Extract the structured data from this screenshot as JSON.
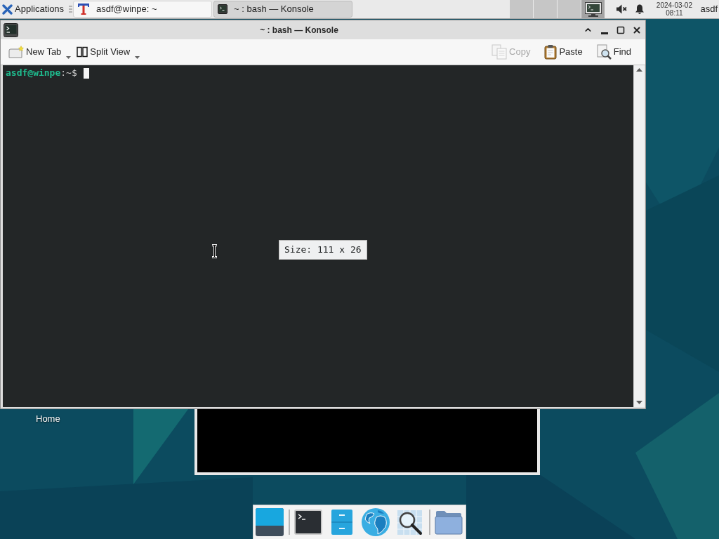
{
  "top_panel": {
    "menu_label": "Applications",
    "tasks": [
      {
        "title": "asdf@winpe: ~",
        "kind": "tlogo",
        "selected": false
      },
      {
        "title": "~ : bash — Konsole",
        "kind": "terminal",
        "selected": true
      }
    ],
    "workspaces": [
      {
        "selected": false
      },
      {
        "selected": false
      },
      {
        "selected": false
      },
      {
        "selected": true
      }
    ],
    "volume": {
      "muted": true
    },
    "clock": {
      "date": "2024-03-02",
      "time": "08:11"
    },
    "user": "asdf"
  },
  "desktop": {
    "icons": [
      {
        "label": "Home"
      }
    ]
  },
  "konsole": {
    "title": "~ : bash — Konsole",
    "toolbar": {
      "left": [
        {
          "label": "New Tab",
          "kind": "newtab",
          "has_menu": true,
          "disabled": false
        },
        {
          "label": "Split View",
          "kind": "split",
          "has_menu": true,
          "disabled": false
        }
      ],
      "right": [
        {
          "label": "Copy",
          "kind": "copy",
          "has_menu": false,
          "disabled": true
        },
        {
          "label": "Paste",
          "kind": "paste",
          "has_menu": false,
          "disabled": false
        },
        {
          "label": "Find",
          "kind": "find",
          "has_menu": false,
          "disabled": false
        }
      ]
    },
    "terminal": {
      "prompt_user": "asdf@winpe",
      "prompt_path": ":~$"
    },
    "tooltip": "Size: 111 x 26"
  }
}
